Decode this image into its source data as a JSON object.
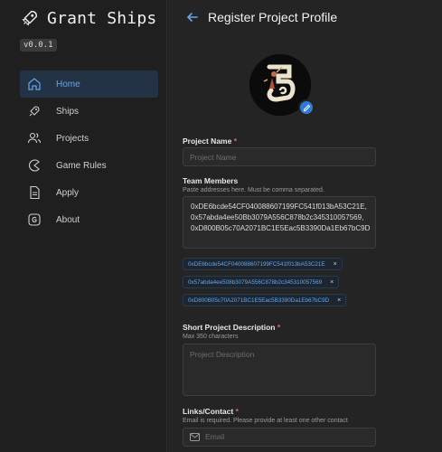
{
  "app": {
    "name": "Grant Ships",
    "version": "v0.0.1"
  },
  "sidebar": {
    "items": [
      {
        "label": "Home",
        "icon": "home-icon",
        "active": true
      },
      {
        "label": "Ships",
        "icon": "rocket-icon"
      },
      {
        "label": "Projects",
        "icon": "users-icon"
      },
      {
        "label": "Game Rules",
        "icon": "pacman-icon"
      },
      {
        "label": "Apply",
        "icon": "file-text-icon"
      },
      {
        "label": "About",
        "icon": "info-icon"
      }
    ]
  },
  "page": {
    "title": "Register Project Profile"
  },
  "form": {
    "project_name": {
      "label": "Project Name",
      "required": "*",
      "placeholder": "Project Name",
      "value": ""
    },
    "team_members": {
      "label": "Team Members",
      "hint": "Paste addresses here. Must be comma separated.",
      "value_lines": [
        "0xDE6bcde54CF040088607199FC541f013bA53C21E,",
        "0x57abda4ee50Bb3079A556C878b2c345310057569,",
        "0xD800B05c70A2071BC1E5Eac5B3390Da1Eb67bC9D"
      ],
      "chips": [
        "0xDE6bcde54CF040088607199FC541f013bA53C21E",
        "0x57abda4ee508b3079A556C878b2c345310057569",
        "0xD800B05c70A2071BC1E5Eac5B3390Da1Eb67bC9D"
      ],
      "chip_close": "×"
    },
    "short_description": {
      "label": "Short Project Description",
      "required": "*",
      "hint": "Max 350 characters",
      "placeholder": "Project Description",
      "value": ""
    },
    "links_contact": {
      "label": "Links/Contact",
      "required": "*",
      "hint": "Email is required. Please provide at least one other contact",
      "email_placeholder": "Email"
    }
  },
  "colors": {
    "accent": "#63a7ec",
    "active_nav_bg": "#233244",
    "required": "#e06a5b",
    "edit_badge": "#2f7ad6"
  }
}
